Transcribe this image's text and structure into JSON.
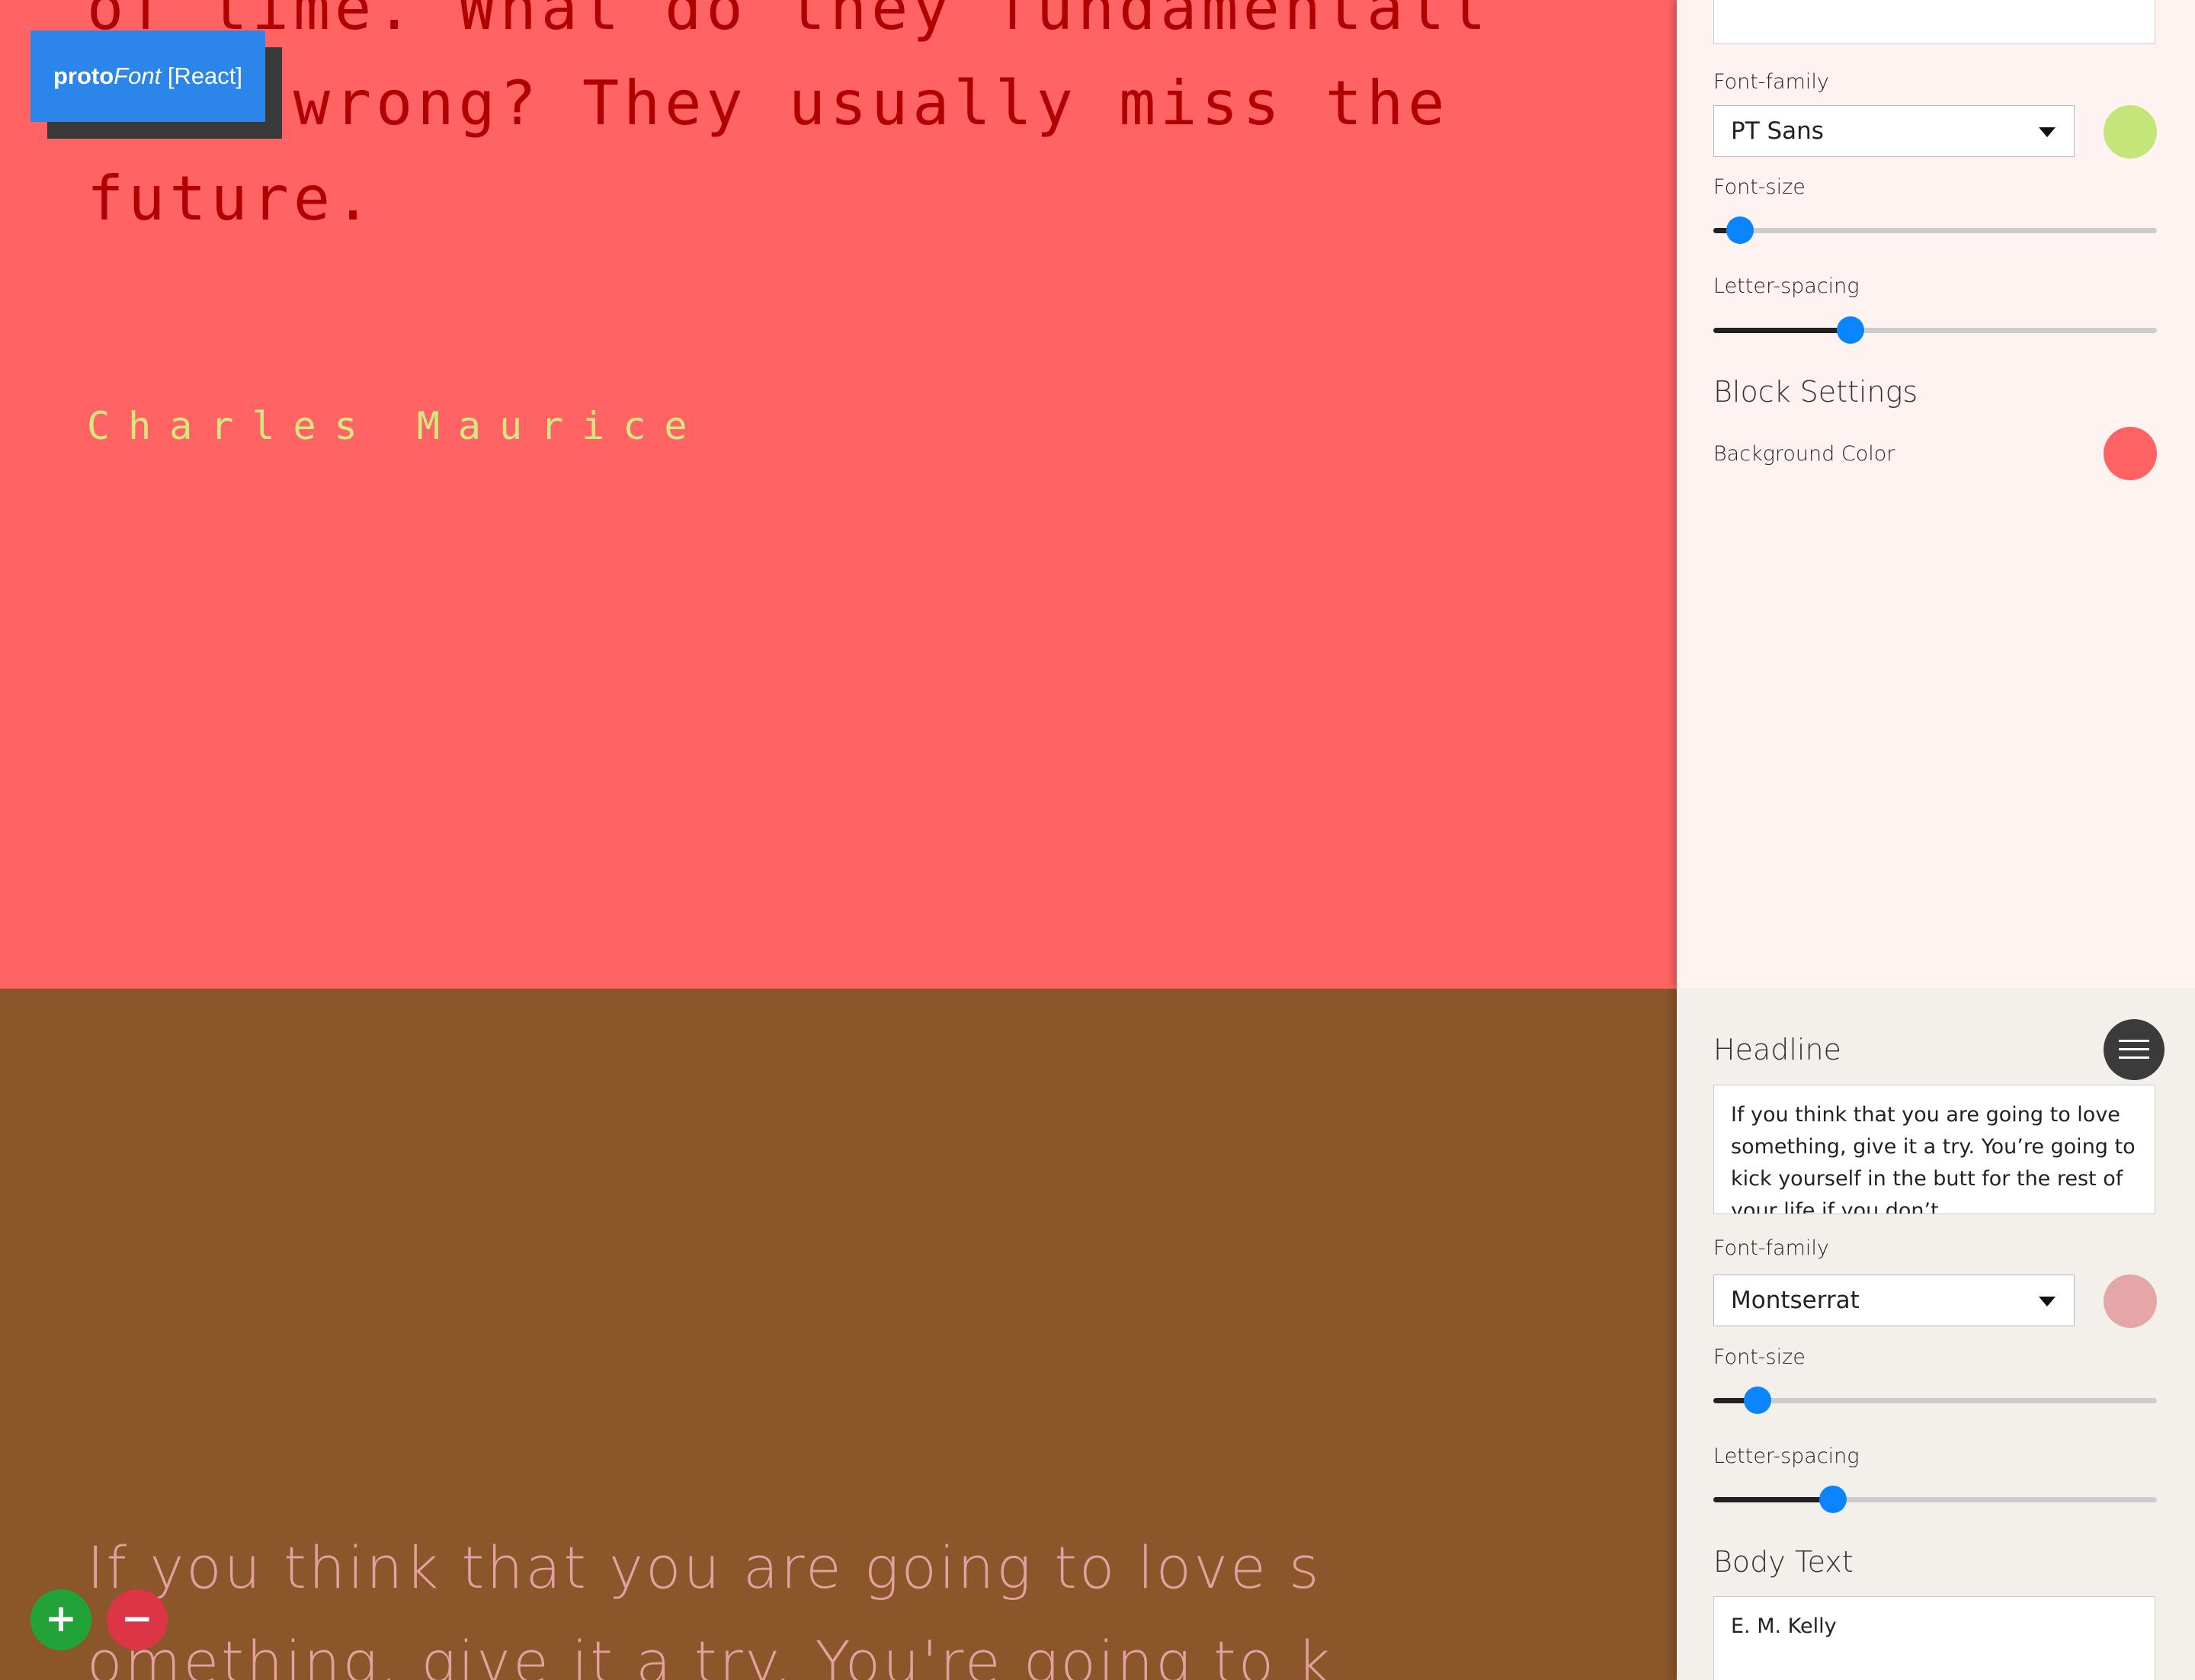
{
  "app": {
    "logo_bold": "proto",
    "logo_italic": "Font",
    "logo_suffix": " [React]",
    "logo_color": "#2c86ea",
    "add_icon": "+",
    "remove_icon": "−"
  },
  "block1": {
    "background": "#ff6363",
    "headline_text": "of time. What do they fundamentall\ny do wrong? They usually miss the\nfuture.",
    "headline_color": "#b00000",
    "author_text": "Charles Maurice",
    "author_color": "#d5e780",
    "panel": {
      "background": "#fff3f2",
      "font_family_label": "Font-family",
      "font_family_value": "PT Sans",
      "font_color": "#c3e57a",
      "font_size_label": "Font-size",
      "font_size_level": 0.06,
      "letter_spacing_label": "Letter-spacing",
      "letter_spacing_level": 0.31,
      "block_settings_label": "Block Settings",
      "background_color_label": "Background Color",
      "background_color_swatch": "#ff6363"
    }
  },
  "block2": {
    "background": "#8a562a",
    "headline_text": "If you think that you are going to love s\nomething, give it a try. You're going to k",
    "headline_color": "#e4a0a0",
    "panel": {
      "background": "#f3f0ec",
      "headline_label": "Headline",
      "headline_value": "If you think that you are going to love something, give it a try. You’re going to kick yourself in the butt for the rest of your life if you don’t.",
      "font_family_label": "Font-family",
      "font_family_value": "Montserrat",
      "font_color": "#e4a6a6",
      "font_size_label": "Font-size",
      "font_size_level": 0.1,
      "letter_spacing_label": "Letter-spacing",
      "letter_spacing_level": 0.27,
      "body_text_label": "Body Text",
      "body_text_value": "E. M. Kelly",
      "menu_icon": "hamburger-menu-icon"
    }
  }
}
